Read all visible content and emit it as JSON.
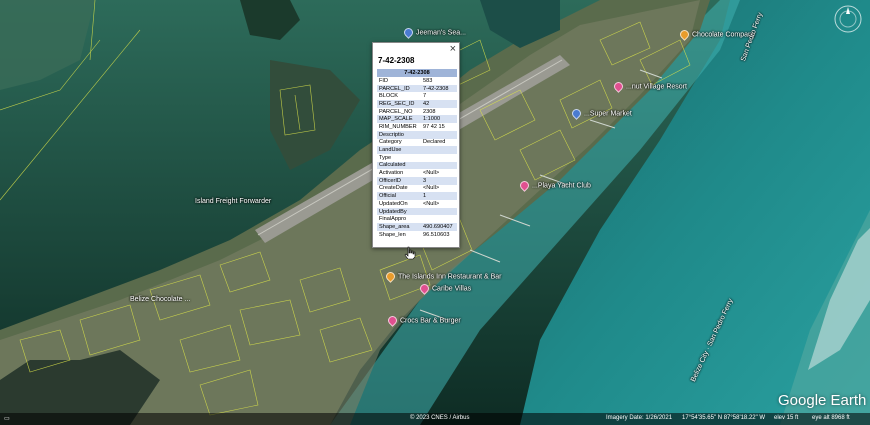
{
  "popup": {
    "title": "7-42-2308",
    "close_label": "×",
    "table_header": "7-42-2308",
    "rows": [
      {
        "key": "FID",
        "value": "583"
      },
      {
        "key": "PARCEL_ID",
        "value": "7-42-2308"
      },
      {
        "key": "BLOCK",
        "value": "7"
      },
      {
        "key": "REG_SEC_ID",
        "value": "42"
      },
      {
        "key": "PARCEL_NO",
        "value": "2308"
      },
      {
        "key": "MAP_SCALE",
        "value": "1:1000"
      },
      {
        "key": "RIM_NUMBER",
        "value": "97 42 15"
      },
      {
        "key": "Descriptio",
        "value": ""
      },
      {
        "key": "Category",
        "value": "Declared"
      },
      {
        "key": "LandUse",
        "value": ""
      },
      {
        "key": "Type",
        "value": ""
      },
      {
        "key": "Calculated",
        "value": ""
      },
      {
        "key": "Activation",
        "value": "<Null>"
      },
      {
        "key": "OfficerID",
        "value": "3"
      },
      {
        "key": "CreateDate",
        "value": "<Null>"
      },
      {
        "key": "Official",
        "value": "1"
      },
      {
        "key": "UpdatedOn",
        "value": "<Null>"
      },
      {
        "key": "UpdatedBy",
        "value": ""
      },
      {
        "key": "FinalAppro",
        "value": ""
      },
      {
        "key": "Shape_area",
        "value": "490.690407"
      },
      {
        "key": "Shape_len",
        "value": "96.510603"
      }
    ]
  },
  "map_labels": {
    "jeemans": "Jeeman's Sea...",
    "choc": "Chocolate Company",
    "village": "...nut Village Resort",
    "market": "...Super Market",
    "yacht": "...Playa Yacht Club",
    "island_freight": "Island Freight Forwarder",
    "islands_inn": "The Islands Inn Restaurant & Bar",
    "caribe": "Caribe Villas",
    "belize": "Belize Chocolate ...",
    "red": "Crocs Bar & Burger",
    "sp_ferry": "San Pedro Ferry",
    "sp_ferry2": "Belize City · San Pedro Ferry"
  },
  "status": {
    "imagery_date": "Imagery Date: 1/26/2021",
    "coords": "17°54'35.65\" N  87°58'18.22\" W",
    "elev": "elev  15 ft",
    "eye_alt": "eye alt  8968 ft",
    "copyright": "© 2023 CNES / Airbus"
  },
  "logo_text": "Google Earth",
  "colors": {
    "header": "#9fb4d8",
    "row_alt": "#d7e1f2",
    "parcel_lines": "#d9e24a"
  }
}
